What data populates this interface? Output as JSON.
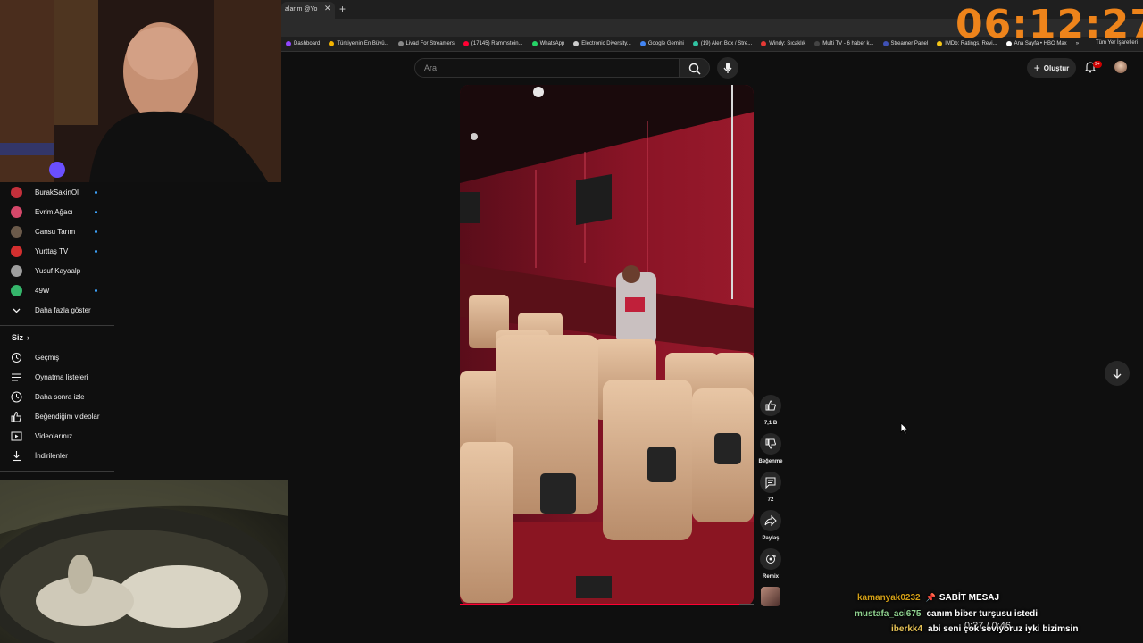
{
  "overlay": {
    "clock": "06:12:27"
  },
  "browser": {
    "tab": {
      "title": "alarım @Yo"
    },
    "bookmarks": [
      {
        "label": "Dashboard",
        "color": "#9146ff"
      },
      {
        "label": "Türkiye'nin En Büyü...",
        "color": "#f4b400"
      },
      {
        "label": "Livad For Streamers",
        "color": "#888888"
      },
      {
        "label": "(17145) Rammstein...",
        "color": "#ff0033"
      },
      {
        "label": "WhatsApp",
        "color": "#25d366"
      },
      {
        "label": "Electronic Diversity...",
        "color": "#cccccc"
      },
      {
        "label": "Google Gemini",
        "color": "#4285f4"
      },
      {
        "label": "(19) Alert Box / Stre...",
        "color": "#31c3a2"
      },
      {
        "label": "Windy: Sıcaklık",
        "color": "#e53935"
      },
      {
        "label": "Multi TV - 6 haber k...",
        "color": "#444444"
      },
      {
        "label": "Streamer Panel",
        "color": "#3f51b5"
      },
      {
        "label": "IMDb: Ratings, Revi...",
        "color": "#f5c518"
      },
      {
        "label": "Ana Sayfa • HBO Max",
        "color": "#ffffff"
      }
    ],
    "bookmarks_more": "»",
    "bookmarks_all": "Tüm Yer İşaretleri"
  },
  "header": {
    "search_placeholder": "Ara",
    "create_label": "Oluştur",
    "notif_badge": "9+"
  },
  "sidebar": {
    "subscriptions": [
      {
        "label": "BurakSakinOl",
        "color": "#c4303b",
        "new": true
      },
      {
        "label": "Evrim Ağacı",
        "color": "#d5486a",
        "new": true
      },
      {
        "label": "Cansu Tarım",
        "color": "#6b5a4a",
        "new": true
      },
      {
        "label": "Yurttaş TV",
        "color": "#d32f2f",
        "new": true
      },
      {
        "label": "Yusuf Kayaalp",
        "color": "#9e9e9e",
        "new": false
      },
      {
        "label": "49W",
        "color": "#35b66b",
        "new": true
      }
    ],
    "show_more": "Daha fazla göster",
    "you_heading": "Siz",
    "you_items": [
      {
        "label": "Geçmiş",
        "icon": "history-icon"
      },
      {
        "label": "Oynatma listeleri",
        "icon": "playlists-icon"
      },
      {
        "label": "Daha sonra izle",
        "icon": "watch-later-icon"
      },
      {
        "label": "Beğendiğim videolar",
        "icon": "liked-icon"
      },
      {
        "label": "Videolarınız",
        "icon": "your-videos-icon"
      },
      {
        "label": "İndirilenler",
        "icon": "downloads-icon"
      }
    ]
  },
  "short": {
    "like_count": "7,1 B",
    "dislike_label": "Beğenme",
    "comment_count": "72",
    "share_label": "Paylaş",
    "remix_label": "Remix",
    "progress": 0.95
  },
  "chat": [
    {
      "user": "kamanyak0232",
      "badge": "📌",
      "message": "SABİT MESAJ",
      "user_color": "#d4a017"
    },
    {
      "user": "mustafa_aci675",
      "message": "canım biber turşusu istedi",
      "user_color": "#8fd18f"
    },
    {
      "user": "iberkk4",
      "message": "abi seni çok seviyoruz iyki bizimsin",
      "user_color": "#e6c255"
    }
  ],
  "player": {
    "time": "0:27 / 0:46"
  }
}
